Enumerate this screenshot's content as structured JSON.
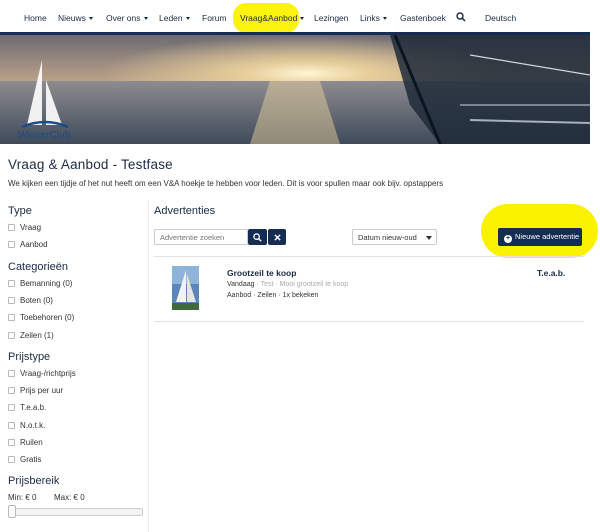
{
  "nav": {
    "items": [
      {
        "label": "Home",
        "dropdown": false
      },
      {
        "label": "Nieuws",
        "dropdown": true
      },
      {
        "label": "Over ons",
        "dropdown": true
      },
      {
        "label": "Leden",
        "dropdown": true
      },
      {
        "label": "Forum",
        "dropdown": false
      },
      {
        "label": "Vraag&Aanbod",
        "dropdown": true
      },
      {
        "label": "Lezingen",
        "dropdown": false
      },
      {
        "label": "Links",
        "dropdown": true
      },
      {
        "label": "Gastenboek",
        "dropdown": false
      },
      {
        "label": "Deutsch",
        "dropdown": false
      }
    ],
    "search_icon": "search-icon",
    "highlight_color": "#fbf200"
  },
  "hero": {
    "logo_text": "WinnerClub"
  },
  "page": {
    "title": "Vraag & Aanbod - Testfase",
    "description": "We kijken een tijdje of het nut heeft om een V&A hoekje te hebben voor leden. Dit is voor spullen maar ook bijv. opstappers"
  },
  "sidebar": {
    "type": {
      "heading": "Type",
      "options": [
        "Vraag",
        "Aanbod"
      ]
    },
    "categories": {
      "heading": "Categorieën",
      "options": [
        "Bemanning (0)",
        "Boten (0)",
        "Toebehoren (0)",
        "Zeilen (1)"
      ]
    },
    "price_type": {
      "heading": "Prijstype",
      "options": [
        "Vraag-/richtprijs",
        "Prijs per uur",
        "T.e.a.b.",
        "N.o.t.k.",
        "Ruilen",
        "Gratis"
      ]
    },
    "price_range": {
      "heading": "Prijsbereik",
      "min_label": "Min: € 0",
      "max_label": "Max: € 0",
      "slider_fraction": 0
    }
  },
  "main": {
    "heading": "Advertenties",
    "search_placeholder": "Advertentie zoeken",
    "sort_selected": "Datum nieuw-oud",
    "new_button_label": "Nieuwe advertentie",
    "accent_color": "#152c53",
    "listings": [
      {
        "title": "Grootzeil te koop",
        "date": "Vandaag",
        "meta": " · Test · Mooi grootzeil te koop",
        "tags": "Aanbod · Zeilen · 1x bekeken",
        "price": "T.e.a.b."
      }
    ]
  }
}
